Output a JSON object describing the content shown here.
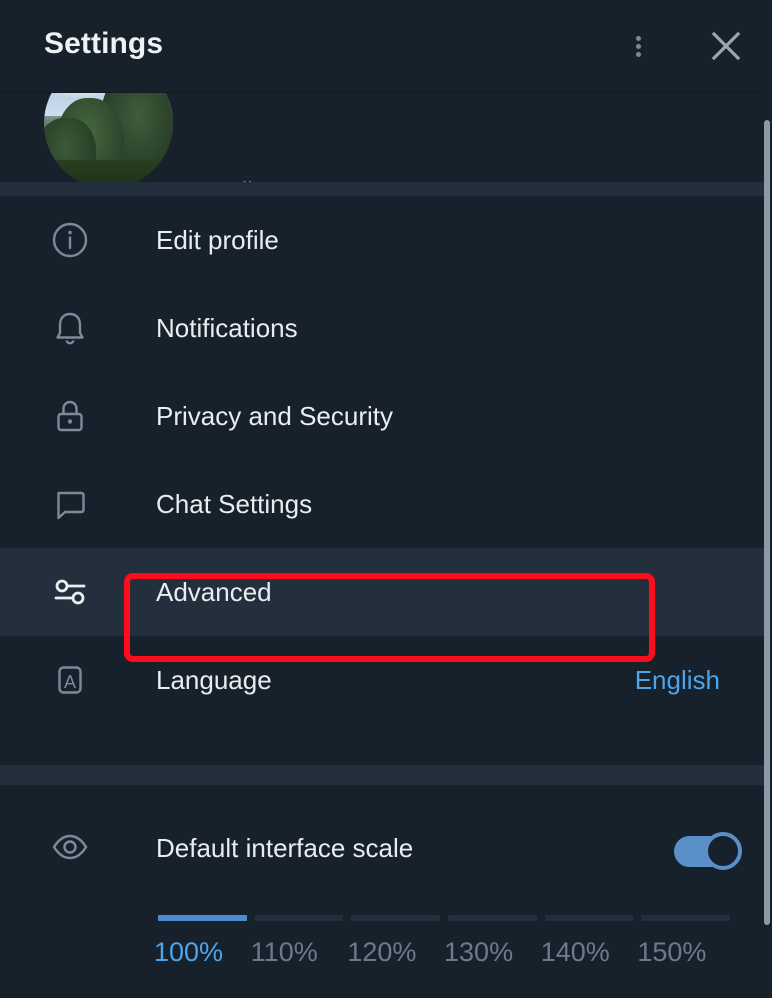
{
  "window": {
    "title": "Settings",
    "background_color": "#17212b",
    "accent_color": "#4ea4e8",
    "annotation_color": "#fb0d1b"
  },
  "header": {
    "title": "Settings",
    "menu_icon": "kebab-menu-icon",
    "close_icon": "close-icon"
  },
  "profile": {
    "avatar_icon": "user-avatar-photo",
    "status": "online",
    "status_color": "#3d87cd"
  },
  "menu": {
    "items": [
      {
        "icon": "info-circle-icon",
        "label": "Edit profile",
        "value": "",
        "active": false
      },
      {
        "icon": "bell-icon",
        "label": "Notifications",
        "value": "",
        "active": false
      },
      {
        "icon": "lock-icon",
        "label": "Privacy and Security",
        "value": "",
        "active": false
      },
      {
        "icon": "chat-bubble-icon",
        "label": "Chat Settings",
        "value": "",
        "active": false
      },
      {
        "icon": "tune-sliders-icon",
        "label": "Advanced",
        "value": "",
        "active": true
      },
      {
        "icon": "language-a-icon",
        "label": "Language",
        "value": "English",
        "active": false
      }
    ]
  },
  "interface_scale": {
    "icon": "eye-icon",
    "label": "Default interface scale",
    "toggle_on": true,
    "selected": "100%",
    "options": [
      "100%",
      "110%",
      "120%",
      "130%",
      "140%",
      "150%"
    ]
  },
  "scrollbar": {
    "name": "vertical-scrollbar"
  }
}
